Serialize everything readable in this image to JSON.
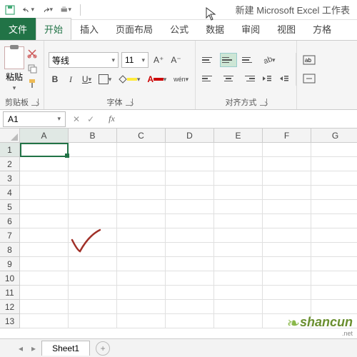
{
  "qat": {
    "title": "新建 Microsoft Excel 工作表"
  },
  "tabs": {
    "file": "文件",
    "home": "开始",
    "insert": "插入",
    "layout": "页面布局",
    "formulas": "公式",
    "data": "数据",
    "review": "审阅",
    "view": "视图",
    "addins": "方格"
  },
  "ribbon": {
    "clipboard": {
      "paste": "粘贴",
      "label": "剪贴板"
    },
    "font": {
      "name": "等线",
      "size": "11",
      "aplus": "A⁺",
      "aminus": "A⁻",
      "bold": "B",
      "italic": "I",
      "underline": "U",
      "wen": "wén",
      "label": "字体"
    },
    "align": {
      "label": "对齐方式"
    }
  },
  "namebox": {
    "ref": "A1",
    "fx": "fx"
  },
  "cols": [
    "A",
    "B",
    "C",
    "D",
    "E",
    "F",
    "G"
  ],
  "rows": [
    "1",
    "2",
    "3",
    "4",
    "5",
    "6",
    "7",
    "8",
    "9",
    "10",
    "11",
    "12",
    "13"
  ],
  "sheet": {
    "name": "Sheet1",
    "add": "+"
  },
  "watermark": {
    "text": "shancun",
    "sub": ".net"
  }
}
